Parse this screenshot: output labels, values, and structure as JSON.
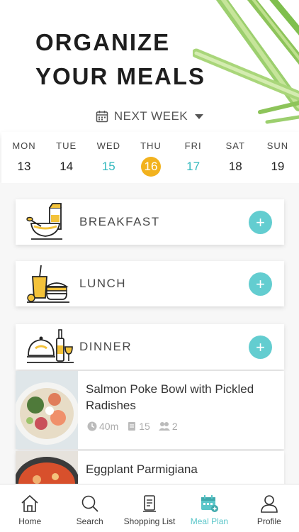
{
  "hero": {
    "title": "ORGANIZE\nYOUR MEALS"
  },
  "week_selector": {
    "label": "NEXT WEEK"
  },
  "days": [
    {
      "name": "MON",
      "num": "13",
      "state": "normal"
    },
    {
      "name": "TUE",
      "num": "14",
      "state": "normal"
    },
    {
      "name": "WED",
      "num": "15",
      "state": "teal"
    },
    {
      "name": "THU",
      "num": "16",
      "state": "active"
    },
    {
      "name": "FRI",
      "num": "17",
      "state": "teal"
    },
    {
      "name": "SAT",
      "num": "18",
      "state": "normal"
    },
    {
      "name": "SUN",
      "num": "19",
      "state": "normal"
    }
  ],
  "meals": [
    {
      "label": "BREAKFAST",
      "icon": "breakfast-icon",
      "add": "+"
    },
    {
      "label": "LUNCH",
      "icon": "lunch-icon",
      "add": "+"
    },
    {
      "label": "DINNER",
      "icon": "dinner-icon",
      "add": "+"
    }
  ],
  "recipes": [
    {
      "title": "Salmon Poke Bowl with Pickled Radishes",
      "time": "40m",
      "ingredients": "15",
      "servings": "2"
    },
    {
      "title": "Eggplant Parmigiana"
    }
  ],
  "tabs": [
    {
      "label": "Home",
      "icon": "home-icon"
    },
    {
      "label": "Search",
      "icon": "search-icon"
    },
    {
      "label": "Shopping List",
      "icon": "shopping-list-icon"
    },
    {
      "label": "Meal Plan",
      "icon": "meal-plan-icon",
      "active": true
    },
    {
      "label": "Profile",
      "icon": "profile-icon"
    }
  ],
  "colors": {
    "accent": "#5ac6c9",
    "active_day": "#f2b21e",
    "teal_day": "#33b8bd"
  }
}
